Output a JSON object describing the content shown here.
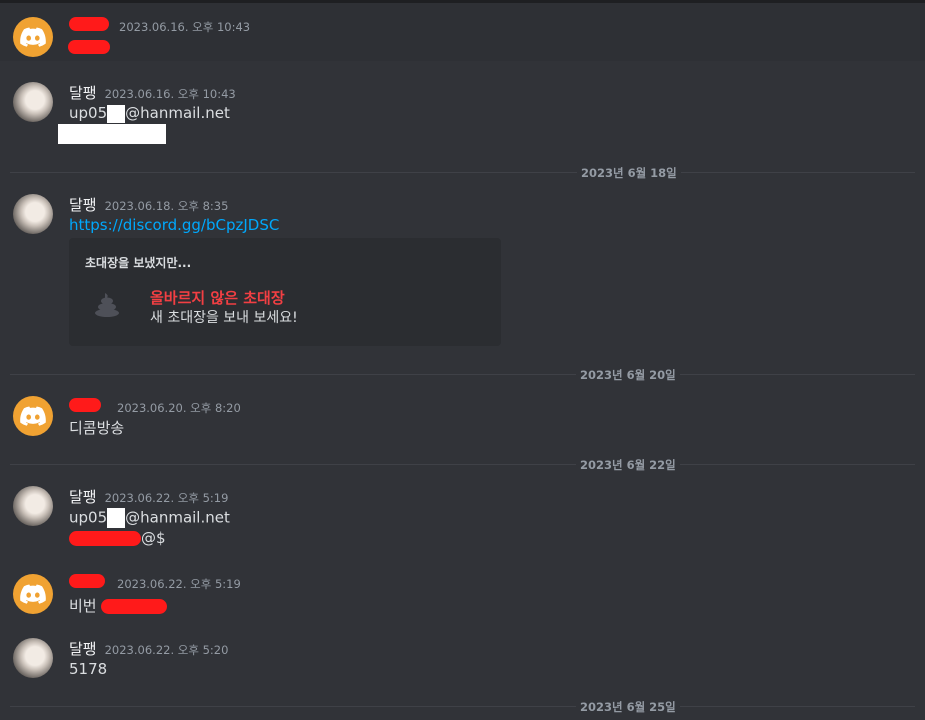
{
  "messages": [
    {
      "author": "",
      "time": "2023.06.16. 오후 10:43",
      "avatar": "discord-icon"
    },
    {
      "author": "달팽",
      "time": "2023.06.16. 오후 10:43",
      "line1_start": "up05",
      "line1_end": "@hanmail.net"
    },
    {
      "author": "달팽",
      "time": "2023.06.18. 오후 8:35",
      "link": "https://discord.gg/bCpzJDSC"
    },
    {
      "author": "",
      "time": "2023.06.20. 오후 8:20",
      "text": "디콤방송"
    },
    {
      "author": "달팽",
      "time": "2023.06.22. 오후 5:19",
      "line1_start": "up05",
      "line1_end": "@hanmail.net",
      "line2_end": "@$"
    },
    {
      "author": "",
      "time": "2023.06.22. 오후 5:19",
      "text_start": "비번"
    },
    {
      "author": "달팽",
      "time": "2023.06.22. 오후 5:20",
      "text": "5178"
    }
  ],
  "invite": {
    "header": "초대장을 보냈지만...",
    "title": "올바르지 않은 초대장",
    "subtitle": "새 초대장을 보내 보세요!",
    "icon": "poop-icon"
  },
  "dividers": [
    "2023년 6월 18일",
    "2023년 6월 20일",
    "2023년 6월 22일",
    "2023년 6월 25일"
  ],
  "colors": {
    "background": "#313338",
    "link": "#00a8fc",
    "error": "#f23f43",
    "discord_avatar": "#f0a232"
  }
}
